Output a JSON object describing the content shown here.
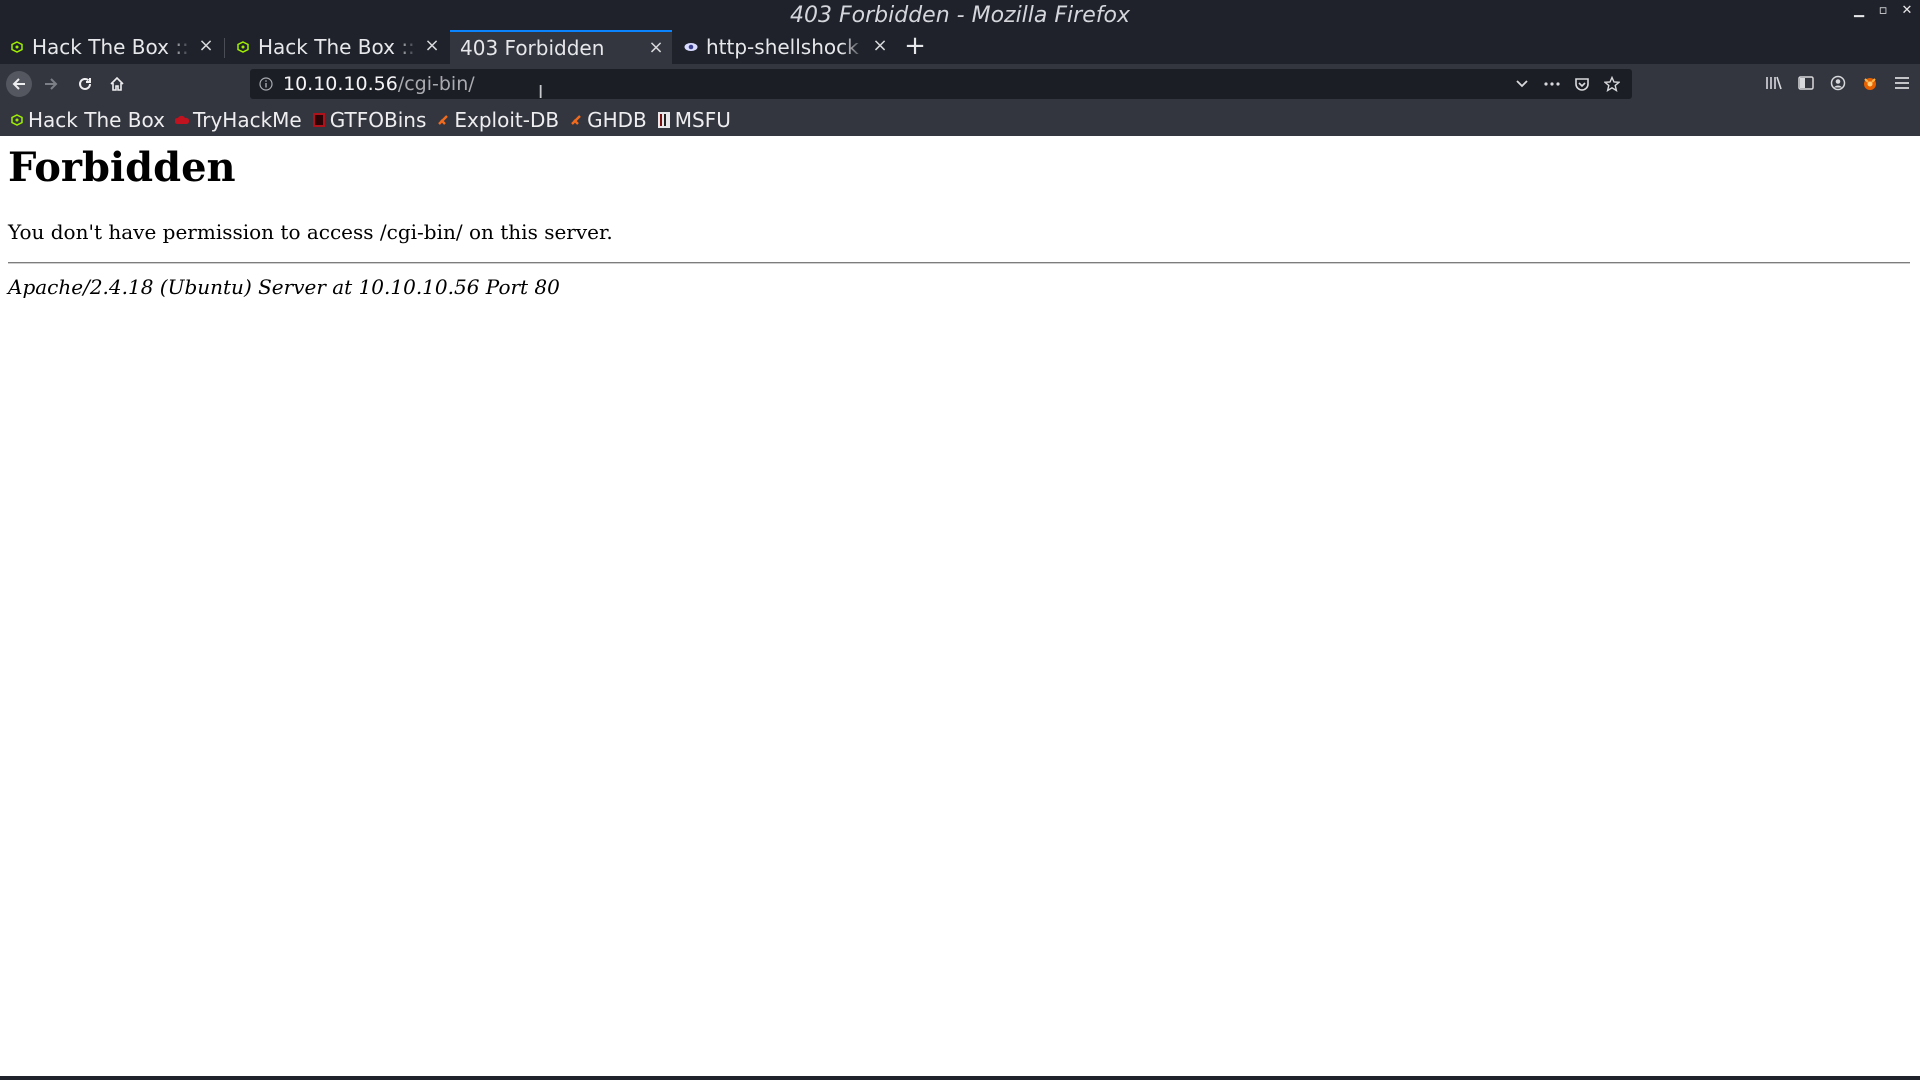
{
  "window": {
    "title": "403 Forbidden - Mozilla Firefox",
    "controls": {
      "minimize": "▁",
      "maximize": "▫",
      "close": "✕"
    }
  },
  "tabs": [
    {
      "label": "Hack The Box :: M",
      "favicon": "htb-cube-icon",
      "active": false
    },
    {
      "label": "Hack The Box :: S",
      "favicon": "htb-cube-icon",
      "active": false
    },
    {
      "label": "403 Forbidden",
      "favicon": "",
      "active": true
    },
    {
      "label": "http-shellshock N",
      "favicon": "nmap-eye-icon",
      "active": false
    }
  ],
  "tab_close_glyph": "×",
  "new_tab_glyph": "+",
  "url": {
    "host": "10.10.10.56",
    "path": "/cgi-bin/"
  },
  "bookmarks": [
    {
      "label": "Hack The Box",
      "icon": "htb-cube-icon"
    },
    {
      "label": "TryHackMe",
      "icon": "tryhackme-icon"
    },
    {
      "label": "GTFOBins",
      "icon": "gtfobins-icon"
    },
    {
      "label": "Exploit-DB",
      "icon": "exploitdb-icon"
    },
    {
      "label": "GHDB",
      "icon": "ghdb-icon"
    },
    {
      "label": "MSFU",
      "icon": "msfu-icon"
    }
  ],
  "page": {
    "heading": "Forbidden",
    "message": "You don't have permission to access /cgi-bin/ on this server.",
    "footer": "Apache/2.4.18 (Ubuntu) Server at 10.10.10.56 Port 80"
  },
  "colors": {
    "chrome_dark": "#1f222b",
    "toolbar": "#33363f",
    "accent_blue": "#0a84ff",
    "htb_green": "#9fef00"
  }
}
